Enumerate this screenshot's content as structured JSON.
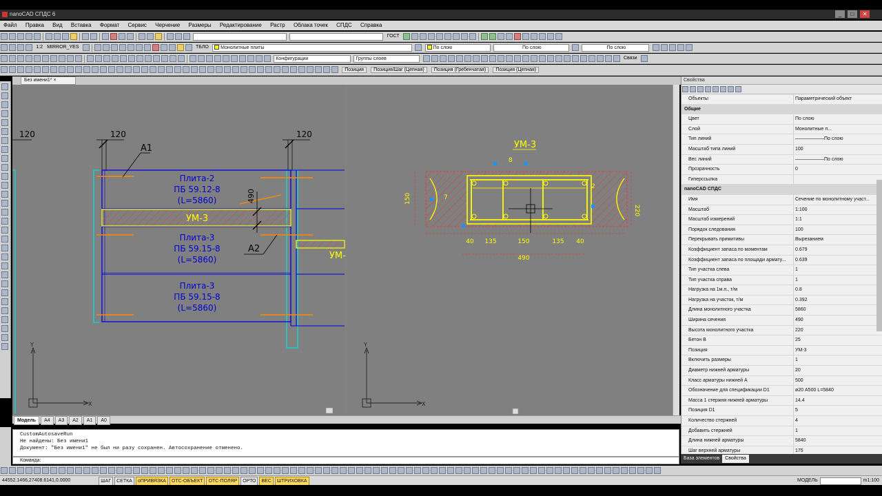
{
  "window": {
    "title": "nanoCAD СПДС 6"
  },
  "menu": [
    "Файл",
    "Правка",
    "Вид",
    "Вставка",
    "Формат",
    "Сервис",
    "Черчение",
    "Размеры",
    "Редактирование",
    "Растр",
    "Облака точек",
    "СПДС",
    "Справка"
  ],
  "toolbar1": {
    "style_label": "ГОСТ"
  },
  "toolbar2": {
    "scale": "1:2",
    "mirror": "MIRROR_YES",
    "tblo": "ТБЛО",
    "layer": "Монолитные плиты",
    "color": "По слою",
    "linetype": "По слою",
    "lineweight": "По слою"
  },
  "toolbar3": {
    "config": "Конфигурации",
    "layer_groups": "Группы слоев",
    "links": "Связи"
  },
  "toolbar4": {
    "pos": "Позиция",
    "pos_step": "Позиция/Шаг (Цепная)",
    "pos_comb": "Позиция (Гребенчатая)",
    "pos_chain": "Позиция (Цепная)"
  },
  "doc_tab": "Без имени1*",
  "drawing": {
    "dims": [
      "120",
      "120",
      "120"
    ],
    "a1": "А1",
    "a2": "А2",
    "dim490": "490",
    "plates": [
      {
        "l1": "Плита-2",
        "l2": "ПБ 59.12-8",
        "l3": "(L=5860)"
      },
      {
        "l1": "Плита-3",
        "l2": "ПБ 59.15-8",
        "l3": "(L=5860)"
      },
      {
        "l1": "Плита-3",
        "l2": "ПБ 59.15-8",
        "l3": "(L=5860)"
      }
    ],
    "um": "УМ-3",
    "um_cut": "УМ-",
    "section": {
      "title": "УМ-3",
      "d8": "8",
      "d7": "7",
      "d2": "2",
      "bot": [
        "40",
        "135",
        "150",
        "135",
        "40"
      ],
      "total": "490",
      "height": "220",
      "left": "150"
    }
  },
  "layout_tabs": [
    "Модель",
    "А4",
    "А3",
    "А2",
    "А1",
    "А0"
  ],
  "cmd_history": [
    "CustomAutosaveRun",
    "Не найдены: Без имени1",
    "Документ: \"Без имени1\" не был ни разу сохранен. Автосохранение отменено."
  ],
  "cmd_prompt": "Команда:",
  "status": {
    "coords": "44552.1466,27408.6141,0.0000",
    "buttons": [
      "ШАГ",
      "СЕТКА",
      "оПРИВЯЗКА",
      "ОТС-ОБЪЕКТ",
      "ОТС-ПОЛЯР",
      "ОРТО",
      "ВЕС",
      "ШТРИХОВКА"
    ],
    "on": [
      false,
      false,
      true,
      true,
      true,
      false,
      true,
      true
    ],
    "model": "МОДЕЛЬ",
    "scale": "m1:100"
  },
  "props": {
    "title": "Свойства",
    "objects_k": "Объекты",
    "objects_v": "Параметрический объект",
    "general": "Общие",
    "rows_general": [
      {
        "k": "Цвет",
        "v": "По слою"
      },
      {
        "k": "Слой",
        "v": "Монолитные п..."
      },
      {
        "k": "Тип линий",
        "v": "——————По слою"
      },
      {
        "k": "Масштаб типа линий",
        "v": "100"
      },
      {
        "k": "Вес линий",
        "v": "——————По слою"
      },
      {
        "k": "Прозрачность",
        "v": "0"
      },
      {
        "k": "Гиперссылка",
        "v": ""
      }
    ],
    "spds": "nanoCAD СПДС",
    "rows_spds": [
      {
        "k": "Имя",
        "v": "Сечение по монолитному участ..."
      },
      {
        "k": "Масштаб",
        "v": "1:100"
      },
      {
        "k": "Масштаб измерений",
        "v": "1:1"
      },
      {
        "k": "Порядок следования",
        "v": "100"
      },
      {
        "k": "Перекрывать примитивы",
        "v": "Вырезанием"
      },
      {
        "k": "Коэффициент запаса по моментам",
        "v": "0.679"
      },
      {
        "k": "Коэффициент запаса по площади армату...",
        "v": "0.639"
      },
      {
        "k": "Тип участка слева",
        "v": "1"
      },
      {
        "k": "Тип участка справа",
        "v": "1"
      },
      {
        "k": "Нагрузка на 1м.п., т/м",
        "v": "0.8"
      },
      {
        "k": "Нагрузка на участок, т/м",
        "v": "0.392"
      },
      {
        "k": "Длина монолитного участка",
        "v": "5860"
      },
      {
        "k": "Ширина сечения",
        "v": "490"
      },
      {
        "k": "Высота монолитного участка",
        "v": "220"
      },
      {
        "k": "Бетон В",
        "v": "25"
      },
      {
        "k": "Позиция",
        "v": "УМ-3"
      },
      {
        "k": "Включить размеры",
        "v": "1"
      },
      {
        "k": "Диаметр нижней арматуры",
        "v": "20"
      },
      {
        "k": "Класс арматуры нижней А",
        "v": "500"
      },
      {
        "k": "Обозначение для спецификации D1",
        "v": "ø20 А500 L=5840"
      },
      {
        "k": "Масса 1 стержня нижней арматуры",
        "v": "14.4"
      },
      {
        "k": "Позиция D1",
        "v": "5"
      },
      {
        "k": "Количество стержней",
        "v": "4"
      },
      {
        "k": "Добавить стержней",
        "v": "1"
      },
      {
        "k": "Длина нижней арматуры",
        "v": "5840"
      },
      {
        "k": "Шаг верхней арматуры",
        "v": "175"
      }
    ],
    "tabs": [
      "База элементов",
      "Свойства"
    ]
  }
}
